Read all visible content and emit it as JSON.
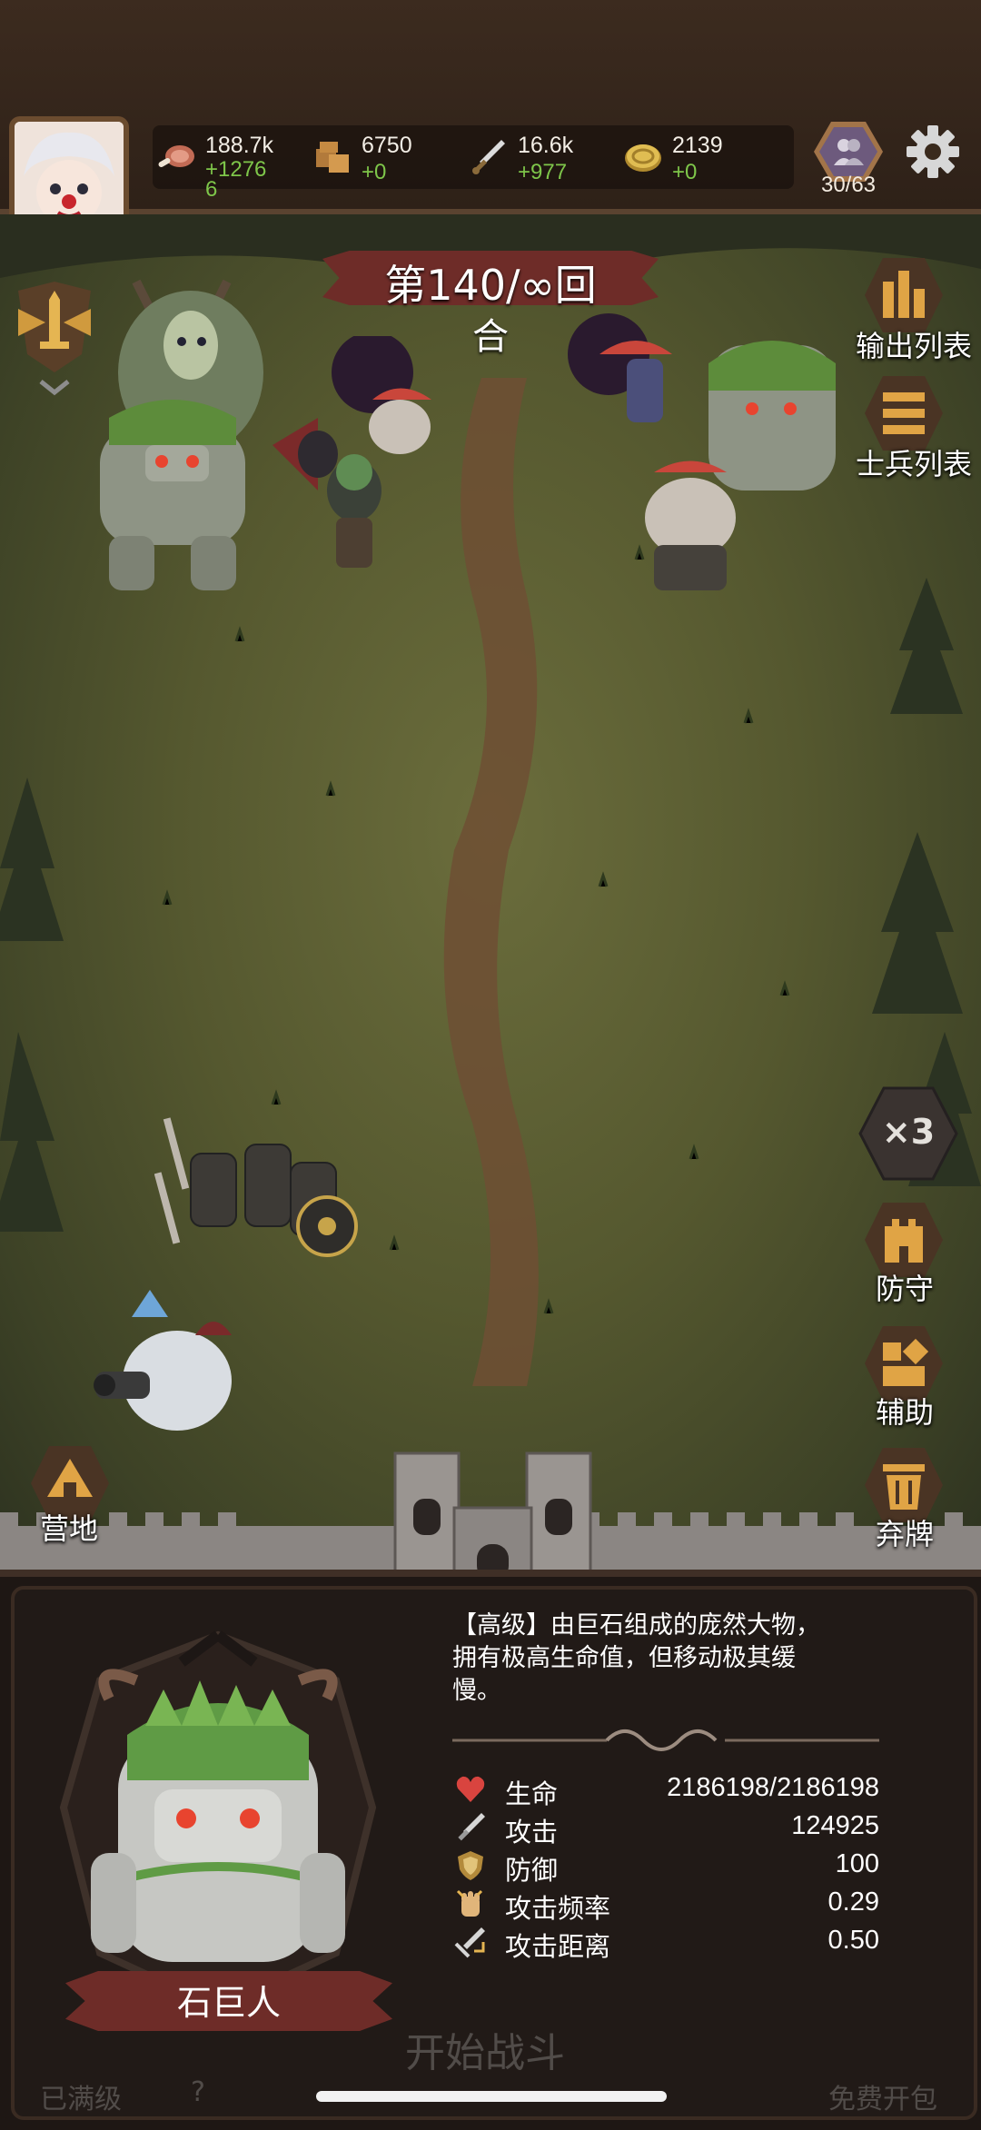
{
  "resources": {
    "meat": {
      "value": "188.7k",
      "delta": "+1276\n6"
    },
    "wood": {
      "value": "6750",
      "delta": "+0"
    },
    "attack": {
      "value": "16.6k",
      "delta": "+977"
    },
    "gold": {
      "value": "2139",
      "delta": "+0"
    }
  },
  "population": "30/63",
  "round": {
    "line1": "第140/∞回",
    "line2": "合"
  },
  "side_right": {
    "output_list": "输出列表",
    "soldier_list": "士兵列表",
    "speed": "×3",
    "defend": "防守",
    "assist": "辅助",
    "discard": "弃牌"
  },
  "side_left": {
    "camp": "营地"
  },
  "unit_info": {
    "description": "【高级】由巨石组成的庞然大物，拥有极高生命值，但移动极其缓慢。",
    "name": "石巨人",
    "stats": [
      {
        "label": "生命",
        "value": "2186198/2186198",
        "icon": "heart-icon"
      },
      {
        "label": "攻击",
        "value": "124925",
        "icon": "sword-icon"
      },
      {
        "label": "防御",
        "value": "100",
        "icon": "shield-icon"
      },
      {
        "label": "攻击频率",
        "value": "0.29",
        "icon": "fist-icon"
      },
      {
        "label": "攻击距离",
        "value": "0.50",
        "icon": "range-sword-icon"
      }
    ]
  },
  "bottom": {
    "maxed": "已满级",
    "question": "?",
    "start_battle": "开始战斗",
    "free_pack": "免费开包"
  },
  "colors": {
    "accent_red": "#6e2c28",
    "grass": "#55582f",
    "positive": "#7ec64a"
  }
}
